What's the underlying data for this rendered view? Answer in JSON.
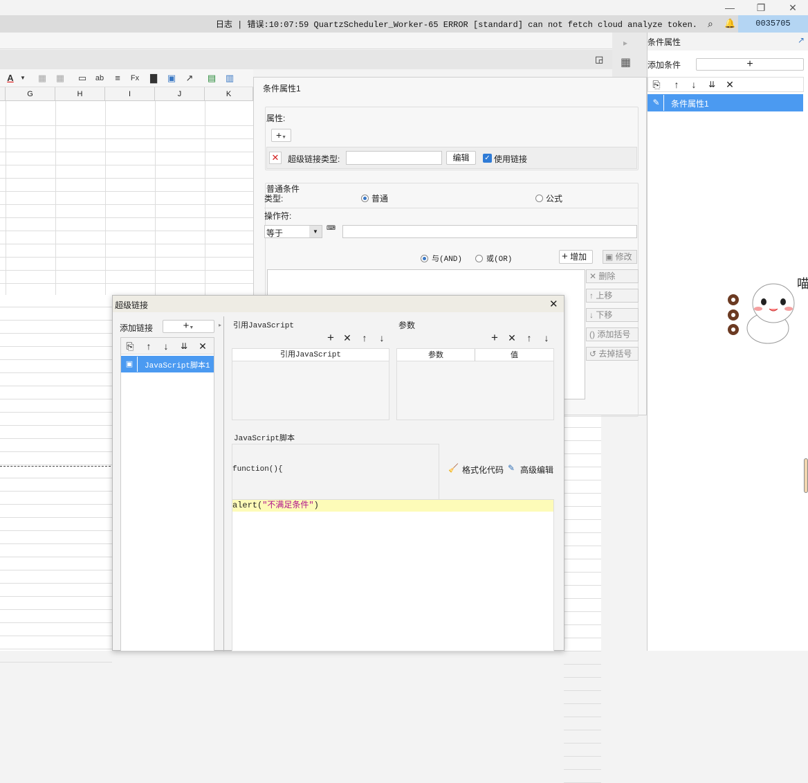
{
  "window": {
    "minimize": "—",
    "restore": "❐",
    "close": "✕"
  },
  "logbar": {
    "text": "日志 | 错误:10:07:59 QuartzScheduler_Worker-65 ERROR [standard] can not fetch cloud analyze token.",
    "user": "0035705"
  },
  "sheet": {
    "columns": [
      "G",
      "H",
      "I",
      "J",
      "K"
    ]
  },
  "right_panel": {
    "title": "条件属性",
    "add_condition_label": "添加条件",
    "add_symbol": "+",
    "items": [
      {
        "label": "条件属性1",
        "selected": true
      }
    ],
    "accent": "#4b9af1"
  },
  "cond_dialog": {
    "title": "条件属性1",
    "attr_section": "属性:",
    "hyperlink_type_label": "超级链接类型:",
    "hyperlink_type_value": "",
    "edit_button": "编辑",
    "use_link_label": "使用链接",
    "use_link_checked": true,
    "normal_cond_section": "普通条件",
    "type_label": "类型:",
    "type_normal": "普通",
    "type_formula": "公式",
    "type_selected": "普通",
    "operator_label": "操作符:",
    "operator_value": "等于",
    "operand_value": "",
    "logic_and": "与(AND)",
    "logic_or": "或(OR)",
    "logic_selected": "与(AND)",
    "buttons": {
      "add": "增加",
      "modify": "修改",
      "delete": "删除",
      "move_up": "上移",
      "move_down": "下移",
      "add_bracket": "添加括号",
      "remove_bracket": "去掉括号"
    }
  },
  "hyperlink_dialog": {
    "title": "超级链接",
    "add_link_label": "添加链接",
    "items": [
      {
        "label": "JavaScript脚本1",
        "selected": true
      }
    ],
    "ref_js_section": "引用JavaScript",
    "ref_js_column": "引用JavaScript",
    "params_section": "参数",
    "params_columns": [
      "参数",
      "值"
    ],
    "js_section": "JavaScript脚本",
    "code_header": "function(){",
    "code_line_prefix": "alert(",
    "code_line_string": "\"不满足条件\"",
    "code_line_suffix": ")",
    "format_code": "格式化代码",
    "advanced_edit": "高级编辑",
    "highlight_color": "#fdfbb8"
  },
  "sticker": {
    "text": "喵"
  }
}
